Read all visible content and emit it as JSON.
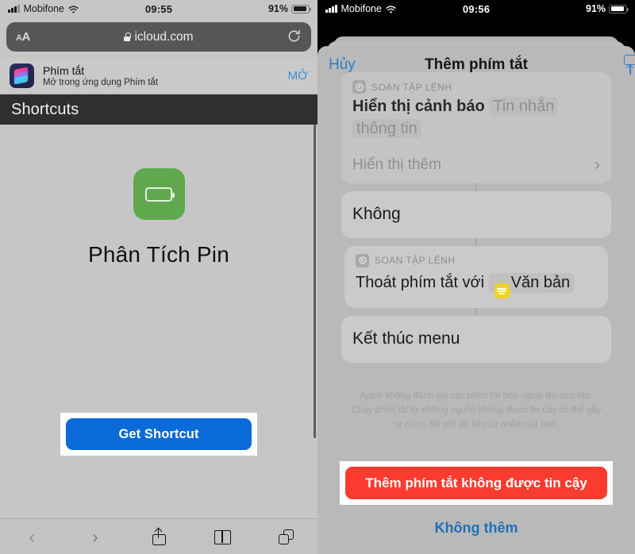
{
  "left_panel": {
    "status_bar": {
      "carrier": "Mobifone",
      "time": "09:55",
      "battery": "91%",
      "signal_icon": "cellular-bars-icon",
      "wifi_icon": "wifi-icon",
      "battery_icon": "battery-icon"
    },
    "browser": {
      "text_size_label": "AA",
      "lock_icon": "lock-icon",
      "url": "icloud.com",
      "reload_icon": "reload-icon"
    },
    "smart_banner": {
      "app_icon": "shortcuts-app-icon",
      "app_name": "Phím tắt",
      "subtitle": "Mở trong ứng dụng Phím tắt",
      "open_label": "MỞ"
    },
    "page": {
      "header_title": "Shortcuts",
      "shortcut_icon": "battery-shortcut-icon",
      "shortcut_name": "Phân Tích Pin",
      "get_button": "Get Shortcut"
    },
    "toolbar": {
      "back_icon": "chevron-left-icon",
      "forward_icon": "chevron-right-icon",
      "share_icon": "share-icon",
      "bookmarks_icon": "book-icon",
      "tabs_icon": "tabs-icon"
    }
  },
  "right_panel": {
    "status_bar": {
      "carrier": "Mobifone",
      "time": "09:56",
      "battery": "91%",
      "signal_icon": "cellular-bars-icon",
      "wifi_icon": "wifi-icon",
      "battery_icon": "battery-icon"
    },
    "sheet": {
      "cancel_label": "Hủy",
      "title": "Thêm phím tắt",
      "share_icon": "share-icon",
      "actions": [
        {
          "kicker": "SOẠN TẬP LỆNH",
          "kicker_icon": "scripting-module-icon",
          "line_main": "Hiển thị cảnh báo",
          "line_token_1": "Tin nhắn",
          "line_token_2": "thông tin",
          "more_label": "Hiển thị thêm",
          "more_chevron_icon": "chevron-right-icon"
        },
        {
          "line_main": "Không"
        },
        {
          "kicker": "SOẠN TẬP LỆNH",
          "kicker_icon": "scripting-module-icon",
          "line_main": "Thoát phím tắt với",
          "badge_icon": "text-badge-icon",
          "badge_label": "Văn bản"
        },
        {
          "line_main": "Kết thúc menu"
        }
      ],
      "disclaimer_lines": [
        "Apple không đánh giá các phím tắt bên ngoài Bộ sưu tập.",
        "Chạy phím tắt từ những nguồn không được tin cậy có thể gây",
        "ra rủi ro đối với dữ liệu cá nhân của bạn."
      ],
      "add_button": "Thêm phím tắt không được tin cậy",
      "dont_add_label": "Không thêm"
    }
  },
  "colors": {
    "blue_button": "#0a6ad8",
    "red_button": "#fb3b30",
    "link_blue": "#2f7fc4",
    "shortcut_green": "#5fa84e",
    "badge_yellow": "#f0d02c"
  }
}
